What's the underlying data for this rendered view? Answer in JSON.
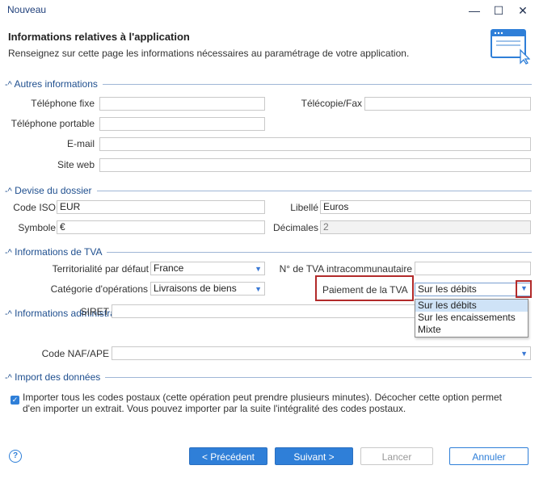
{
  "window": {
    "title": "Nouveau",
    "minimize": "—",
    "maximize": "☐",
    "close": "✕"
  },
  "header": {
    "title": "Informations relatives à l'application",
    "subtitle": "Renseignez sur cette page les informations nécessaires au paramétrage de votre application."
  },
  "sections": {
    "autres": "Autres informations",
    "devise": "Devise du dossier",
    "tva": "Informations de TVA",
    "admin": "Informations administratives",
    "import": "Import des données"
  },
  "autres": {
    "telephone_fixe_label": "Téléphone fixe",
    "telephone_fixe_value": "",
    "telecopie_label": "Télécopie/Fax",
    "telecopie_value": "",
    "telephone_portable_label": "Téléphone portable",
    "telephone_portable_value": "",
    "email_label": "E-mail",
    "email_value": "",
    "site_web_label": "Site web",
    "site_web_value": ""
  },
  "devise": {
    "code_iso_label": "Code ISO",
    "code_iso_value": "EUR",
    "libelle_label": "Libellé",
    "libelle_value": "Euros",
    "symbole_label": "Symbole",
    "symbole_value": "€",
    "decimales_label": "Décimales",
    "decimales_value": "2"
  },
  "tva": {
    "territorialite_label": "Territorialité par défaut",
    "territorialite_value": "France",
    "num_tva_label": "N° de TVA intracommunautaire",
    "num_tva_value": "",
    "categorie_label": "Catégorie d'opérations",
    "categorie_value": "Livraisons de biens",
    "paiement_label": "Paiement de la TVA",
    "paiement_value": "Sur les débits",
    "paiement_options": [
      "Sur les débits",
      "Sur les encaissements",
      "Mixte"
    ]
  },
  "admin": {
    "siret_label": "SIRET",
    "siret_value": "",
    "naf_label": "Code NAF/APE",
    "naf_value": ""
  },
  "import": {
    "checkbox_checked": true,
    "text_line1": "Importer tous les codes postaux (cette opération peut prendre plusieurs minutes). Décocher cette option permet",
    "text_line2": "d'en importer un extrait. Vous pouvez importer par la suite l'intégralité des codes postaux."
  },
  "footer": {
    "help": "?",
    "prev_label": "< Précédent",
    "next_label": "Suivant >",
    "finish_label": "Lancer",
    "cancel_label": "Annuler"
  },
  "colors": {
    "accent": "#2f7fd8",
    "highlight_border": "#b22a2a",
    "section_text": "#1f4f8f"
  },
  "icons": [
    "window-icon",
    "chevron-up-icon",
    "dropdown-arrow-icon",
    "check-icon",
    "help-icon"
  ]
}
